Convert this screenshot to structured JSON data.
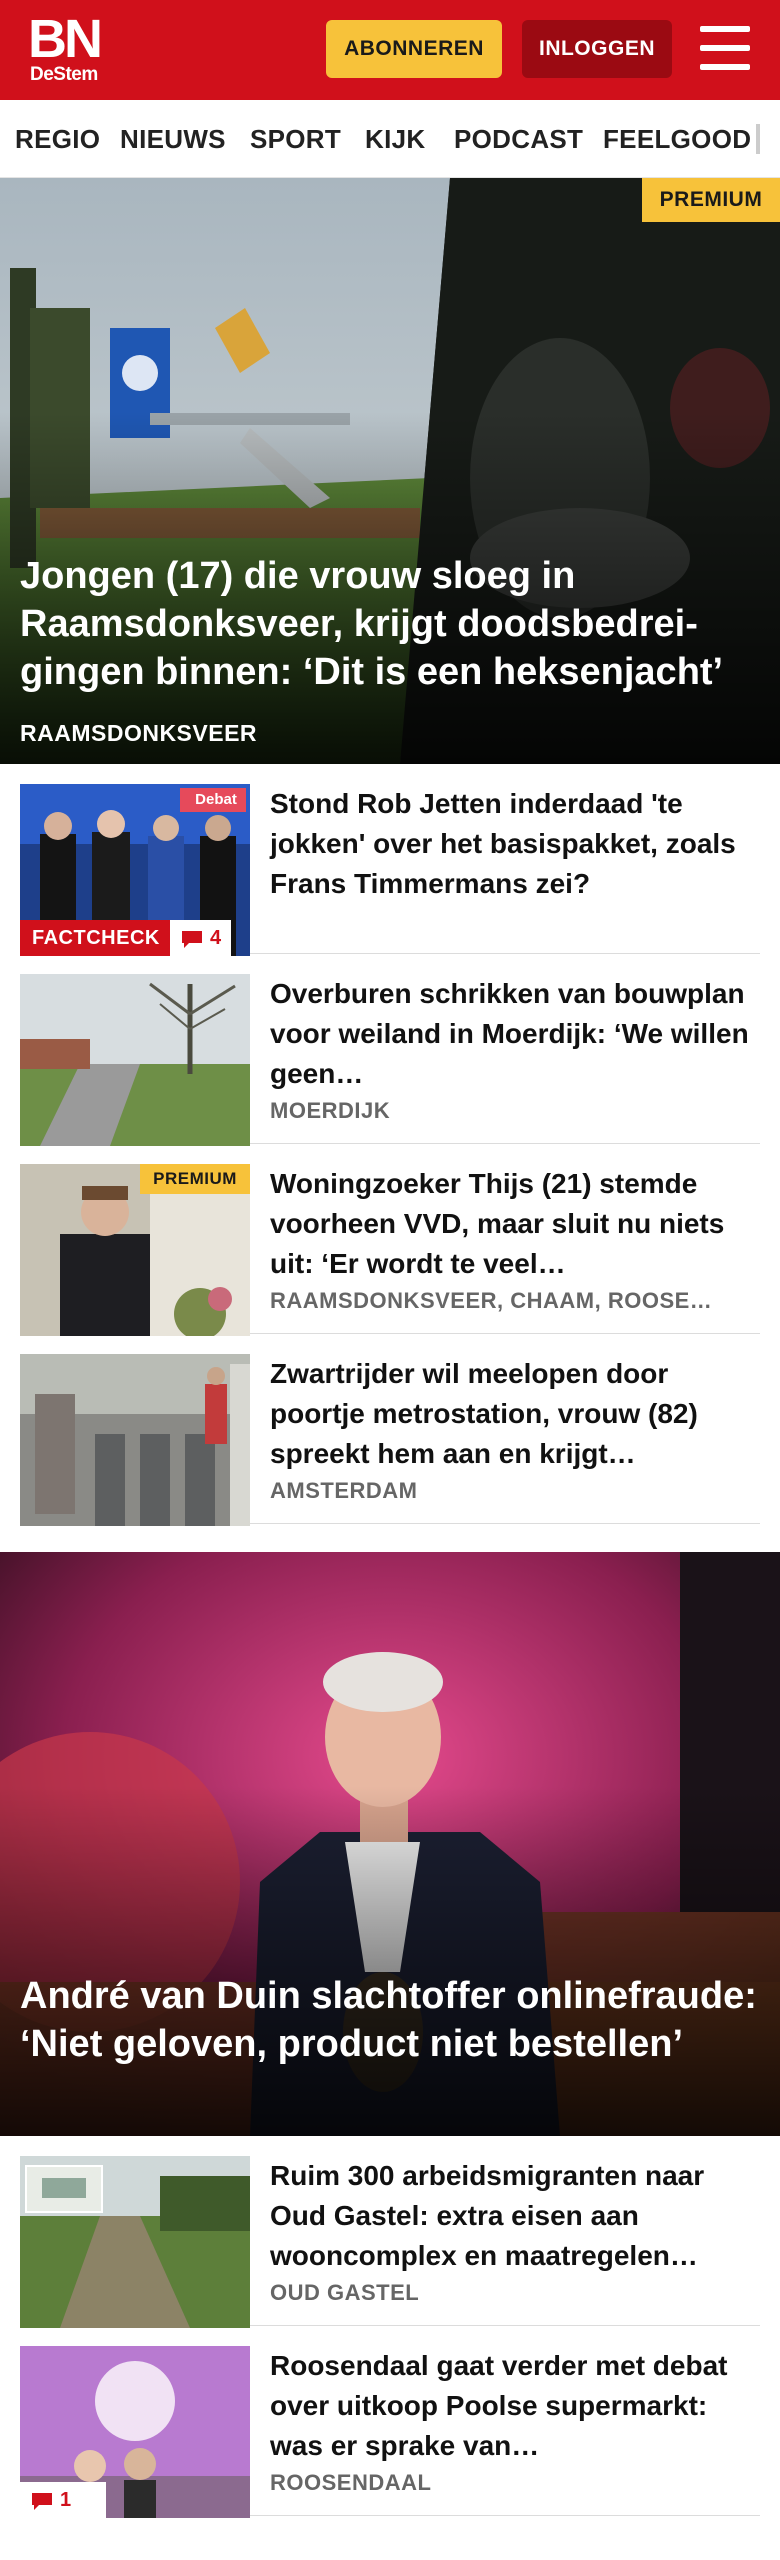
{
  "header": {
    "logo_main": "BN",
    "logo_sub": "DeStem",
    "subscribe_label": "ABONNEREN",
    "login_label": "INLOGGEN",
    "brand_color": "#d0101b",
    "accent_color": "#f7c23a"
  },
  "nav": {
    "items": [
      "REGIO",
      "NIEUWS",
      "SPORT",
      "KIJK",
      "PODCAST",
      "FEELGOOD"
    ]
  },
  "hero1": {
    "title": "Jongen (17) die vrouw sloeg in Raamsdonksveer, krijgt doodsbedrei­gingen binnen: ‘Dit is een heksenjacht’",
    "tag": "RAAMSDONKSVEER",
    "badge": "PREMIUM"
  },
  "articles": [
    {
      "title": "Stond Rob Jetten inderdaad 'te jokken' over het basispakket, zoals Frans Timmermans zei?",
      "tag": "",
      "label": "FACTCHECK",
      "comments": "4",
      "thumb_label": "Debat"
    },
    {
      "title": "Overburen schrikken van bouwplan voor weiland in Moerdijk: ‘We willen geen…",
      "tag": "MOERDIJK"
    },
    {
      "title": "Woningzoeker Thijs (21) stemde voorheen VVD, maar sluit nu niets uit: ‘Er wordt te veel…",
      "tag": "RAAMSDONKSVEER, CHAAM, ROOSE…",
      "badge": "PREMIUM"
    },
    {
      "title": "Zwartrijder wil meelopen door poortje metrostation, vrouw (82) spreekt hem aan en krijgt…",
      "tag": "AMSTERDAM"
    }
  ],
  "hero2": {
    "title": "André van Duin slachtoffer onlinefraude: ‘Niet geloven, product niet bestellen’"
  },
  "articles2": [
    {
      "title": "Ruim 300 arbeidsmigranten naar Oud Gastel: extra eisen aan wooncomplex en maatregelen…",
      "tag": "OUD GASTEL"
    },
    {
      "title": "Roosendaal gaat verder met debat over uitkoop Poolse supermarkt: was er sprake van…",
      "tag": "ROOSENDAAL",
      "comments": "1"
    }
  ]
}
